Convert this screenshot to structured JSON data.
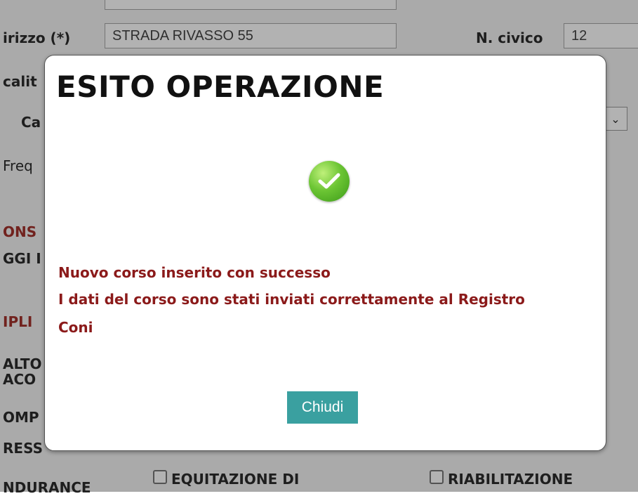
{
  "form": {
    "indirizzo_label": "irizzo (*)",
    "indirizzo_value": "STRADA RIVASSO 55",
    "civico_label": "N. civico",
    "civico_value": "12",
    "localita_label": "calit",
    "cap_label": "Ca",
    "freq_label": "Freq",
    "section_label_1": "ONS",
    "section_label_2": "GGI I",
    "discipline_label": "IPLI",
    "item_salto": "ALTO",
    "item_acc": "ACO",
    "item_comp": "OMP",
    "item_ress": "RESS",
    "item_endurance": "NDURANCE",
    "checkbox_equitazione": "EQUITAZIONE DI",
    "checkbox_riabilitazione": "RIABILITAZIONE"
  },
  "modal": {
    "title": "ESITO OPERAZIONE",
    "icon": "success-check-icon",
    "message_line1": "Nuovo corso inserito con successo",
    "message_line2": "I dati del corso sono stati inviati correttamente al Registro Coni",
    "close_button": "Chiudi"
  },
  "colors": {
    "message": "#8b1a1a",
    "button": "#3aa0a0",
    "success": "#6cc534"
  }
}
